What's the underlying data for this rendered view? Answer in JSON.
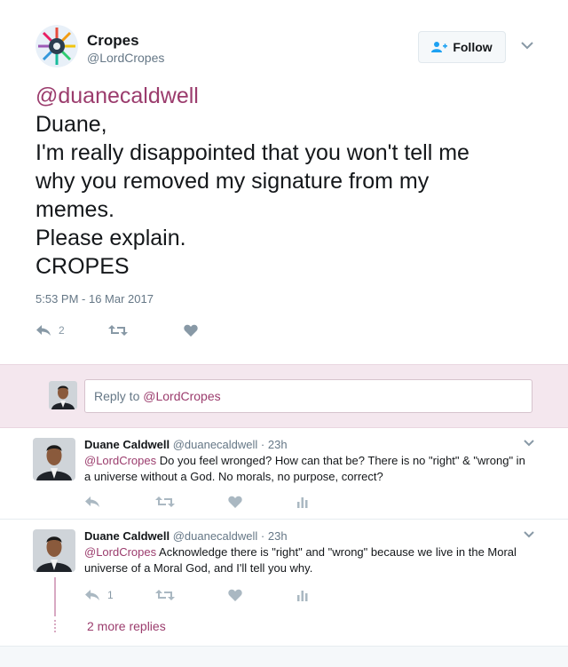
{
  "main_tweet": {
    "author_name": "Cropes",
    "author_handle": "@LordCropes",
    "follow_label": "Follow",
    "mention": "@duanecaldwell",
    "lines": [
      "Duane,",
      "I'm really disappointed that you won't tell me",
      "why you removed my signature from my",
      "memes.",
      "Please explain.",
      "CROPES"
    ],
    "timestamp": "5:53 PM - 16 Mar 2017",
    "reply_count": "2"
  },
  "reply_box": {
    "prefix": "Reply to ",
    "mention": "@LordCropes"
  },
  "replies": [
    {
      "name": "Duane Caldwell",
      "handle": "@duanecaldwell",
      "time": "· 23h",
      "mention": "@LordCropes",
      "text": " Do you feel wronged? How can that be? There is no \"right\" & \"wrong\" in a universe without a God. No morals, no purpose, correct?",
      "reply_count": ""
    },
    {
      "name": "Duane Caldwell",
      "handle": "@duanecaldwell",
      "time": "· 23h",
      "mention": "@LordCropes",
      "text": " Acknowledge there is \"right\" and \"wrong\" because we live in the Moral universe of a Moral God, and I'll tell you why.",
      "reply_count": "1"
    }
  ],
  "more_replies": "2 more replies",
  "colors": {
    "accent": "#9b3c6d",
    "muted": "#657786",
    "icon": "#8899a6",
    "reply_bar": "#f4e7ee"
  }
}
